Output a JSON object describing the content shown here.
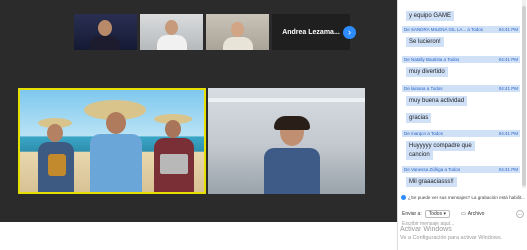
{
  "participants": {
    "name_tile": "Andrea Lezama...",
    "next_icon": "chevron-right-icon"
  },
  "chat": {
    "top_message": "y equipo GAME",
    "lines": [
      {
        "from": "De SANDRA MILENA GIL LA... a Todos",
        "time": "04:41 PM",
        "message": "Se lucieron!"
      },
      {
        "from": "De Natally Bautista a Todos",
        "time": "04:41 PM",
        "message": "muy divertido"
      },
      {
        "from": "De lainana a Todos",
        "time": "04:41 PM",
        "message": "muy buena actividad"
      },
      {
        "from": "",
        "time": "",
        "message": "gracias"
      },
      {
        "from": "De marqcn a Todos",
        "time": "04:41 PM",
        "message": "Huyyyyy compadre que"
      },
      {
        "from": "",
        "time": "",
        "message": "cancion"
      },
      {
        "from": "De Vanessa Zúñiga a Todos",
        "time": "04:41 PM",
        "message": "Mil graaaciasss!!"
      }
    ],
    "notice": "¿Se puede ver sus mensajes? La grabación está habilit...",
    "send_label": "Enviar a:",
    "send_target": "Todos",
    "file_label": "Archivo",
    "more_label": "...",
    "input_placeholder": "Escribir mensaje aquí..."
  },
  "os_watermark": {
    "title": "Activar Windows",
    "subtitle": "Ve a Configuración para activar Windows."
  },
  "colors": {
    "chat_highlight": "#cfe0f7",
    "chat_link": "#2b66c8",
    "speaker_border": "#e6e000",
    "zoom_blue": "#2d8cff"
  }
}
